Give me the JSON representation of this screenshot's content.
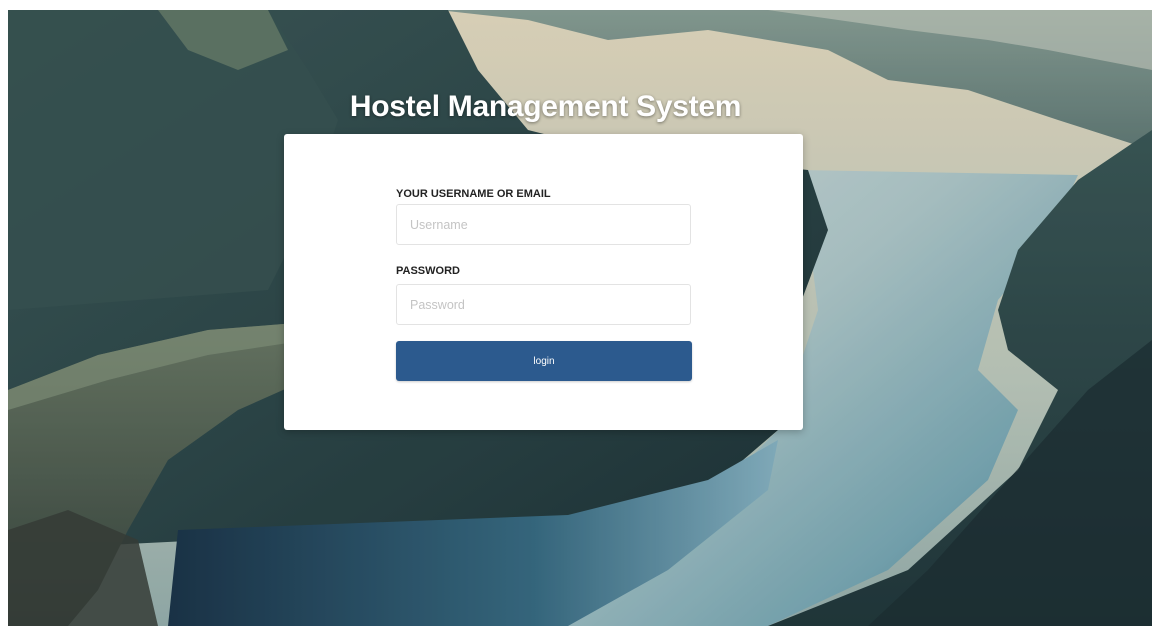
{
  "app": {
    "title": "Hostel Management System"
  },
  "login_form": {
    "username_label": "YOUR USERNAME OR EMAIL",
    "username_placeholder": "Username",
    "username_value": "",
    "password_label": "PASSWORD",
    "password_placeholder": "Password",
    "password_value": "",
    "submit_label": "login"
  },
  "colors": {
    "button": "#2c5a8e",
    "card": "#ffffff",
    "label_text": "#222222",
    "title_text": "#ffffff"
  }
}
